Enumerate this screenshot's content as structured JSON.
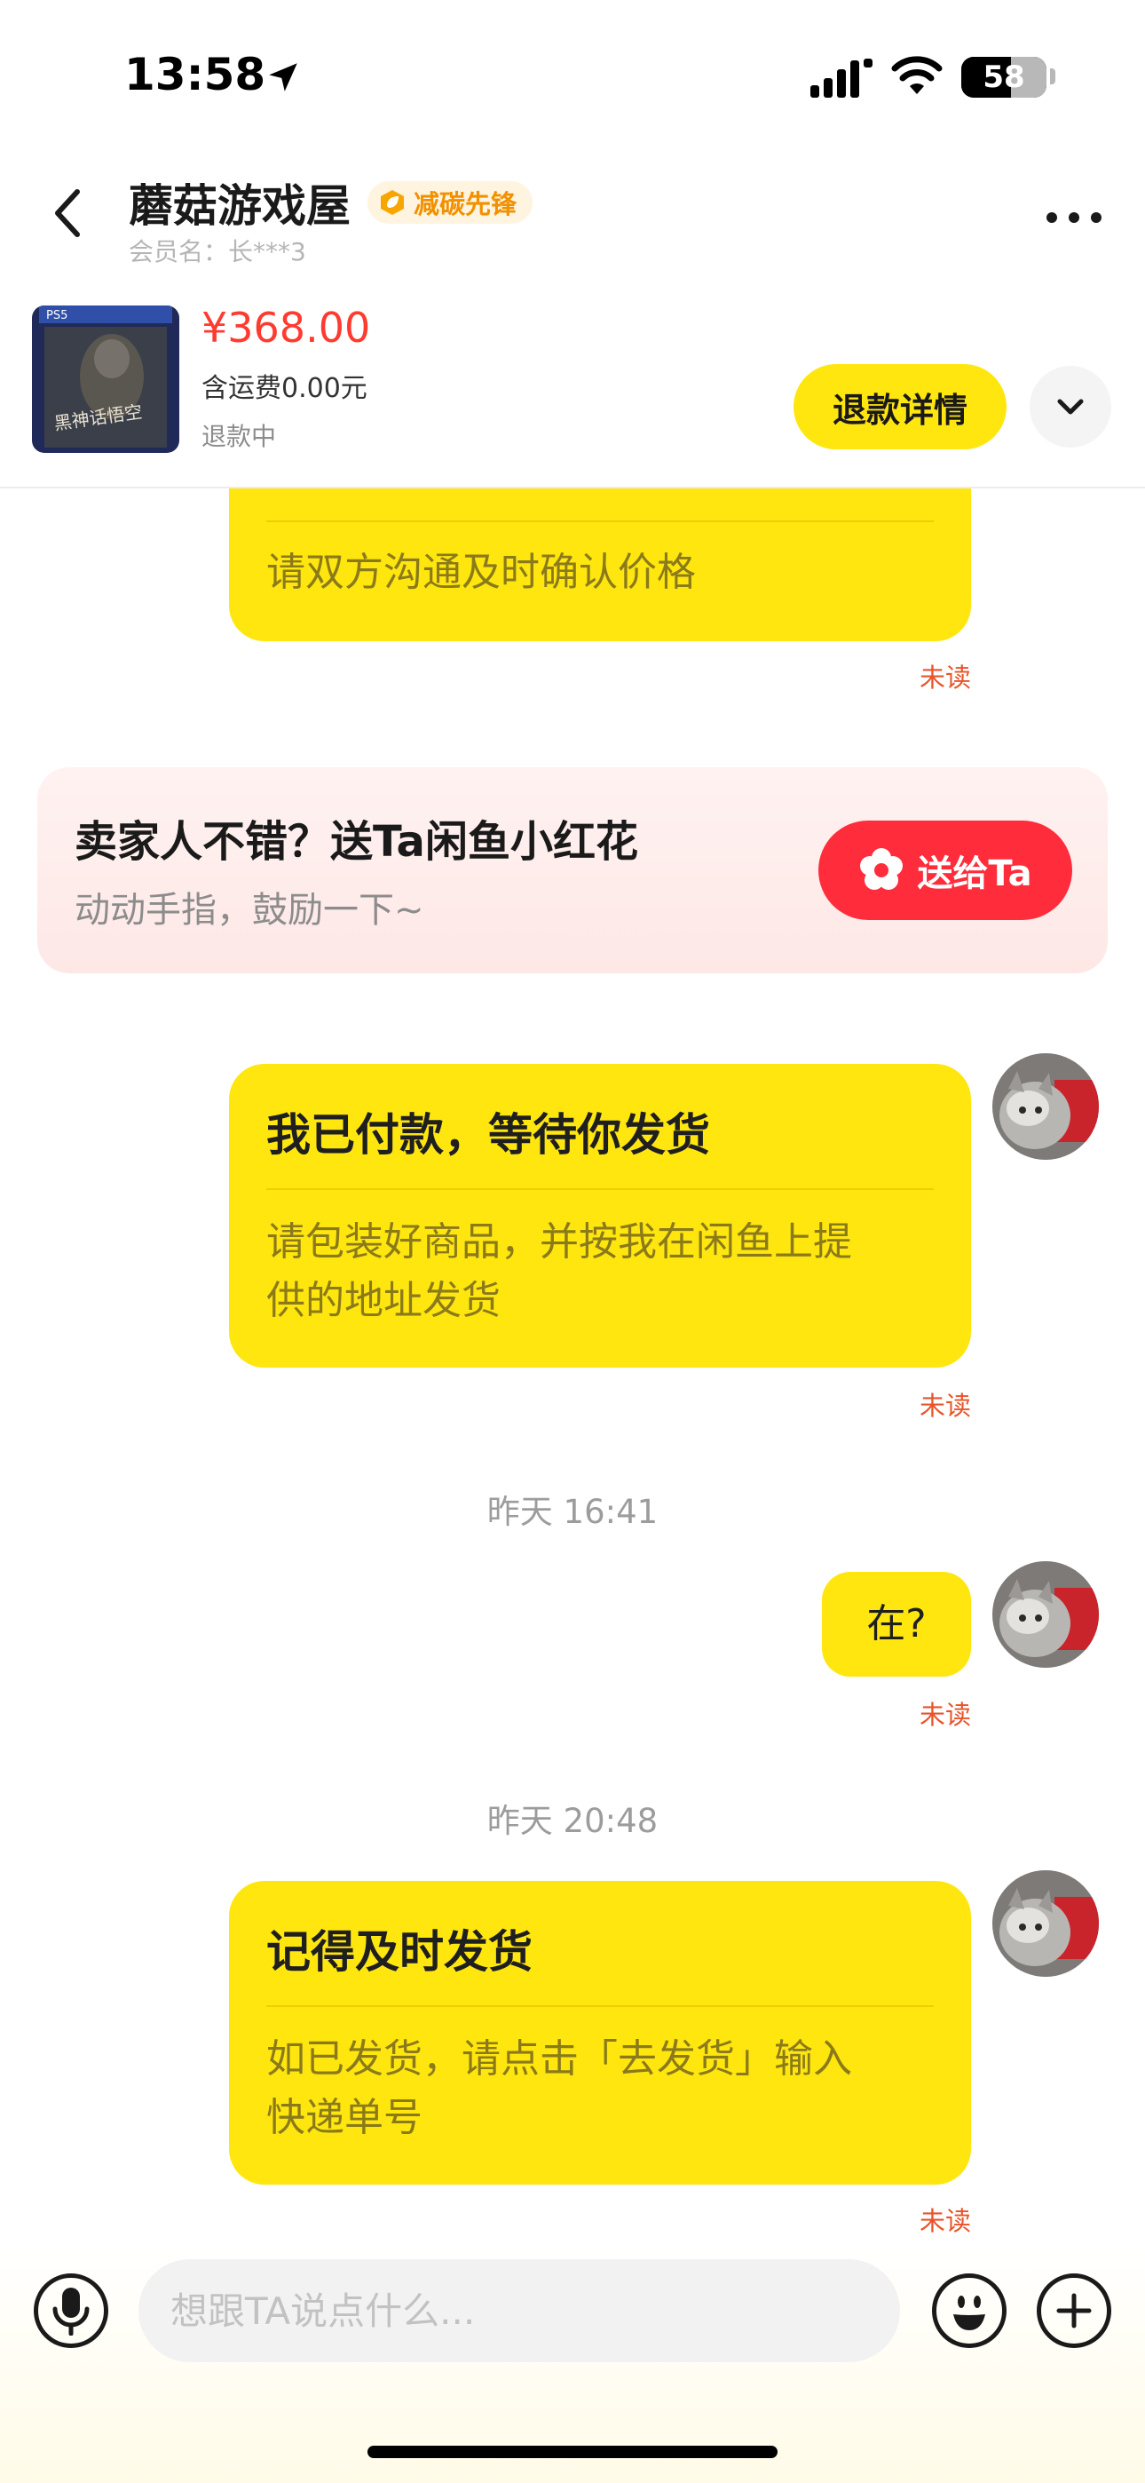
{
  "status_bar": {
    "time": "13:58",
    "battery": "58",
    "battery_level": 0.58,
    "icons": [
      "location-arrow-icon",
      "signal-icon",
      "wifi-icon",
      "battery-icon"
    ]
  },
  "header": {
    "back_icon": "chevron-left-icon",
    "shop_name": "蘑菇游戏屋",
    "badge": "减碳先锋",
    "badge_icon": "leaf-badge-icon",
    "member_label": "会员名：",
    "member_name": "长***3",
    "more_icon": "more-dots-icon"
  },
  "product": {
    "price": "¥368.00",
    "shipping": "含运费0.00元",
    "status": "退款中",
    "refund_button": "退款详情",
    "expand_icon": "chevron-down-icon",
    "thumbnail_label": "PS5",
    "thumbnail_title": "黑神话悟空"
  },
  "messages": [
    {
      "subtitle": "请双方沟通及时确认价格",
      "read_status": "未读"
    },
    {
      "title": "我已付款，等待你发货",
      "subtitle_line1": "请包装好商品，并按我在闲鱼上提",
      "subtitle_line2": "供的地址发货",
      "read_status": "未读"
    },
    {
      "timestamp": "昨天 16:41",
      "text": "在?",
      "read_status": "未读"
    },
    {
      "timestamp": "昨天 20:48",
      "title": "记得及时发货",
      "subtitle_line1": "如已发货，请点击「去发货」输入",
      "subtitle_line2": "快递单号",
      "read_status": "未读"
    }
  ],
  "flower_card": {
    "title": "卖家人不错？送Ta闲鱼小红花",
    "subtitle": "动动手指，鼓励一下~",
    "button": "送给Ta",
    "button_icon": "flower-icon"
  },
  "input_bar": {
    "placeholder": "想跟TA说点什么...",
    "mic_icon": "microphone-icon",
    "emoji_icon": "emoji-smile-icon",
    "plus_icon": "plus-icon"
  },
  "colors": {
    "bubble": "#ffe60f",
    "accent_red": "#ff2d3c",
    "price_red": "#ff3b30",
    "unread_orange": "#e8542a",
    "badge_orange": "#f29100"
  }
}
